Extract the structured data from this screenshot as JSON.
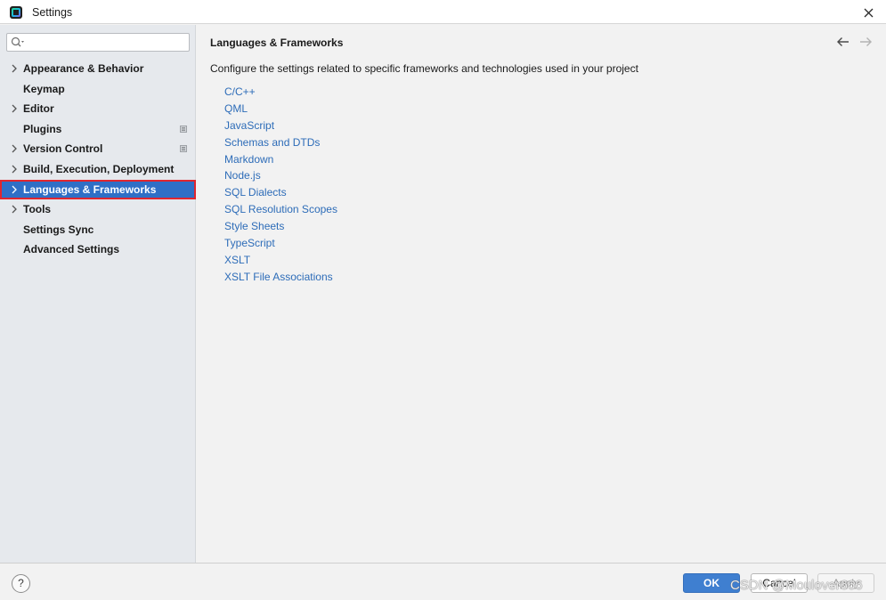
{
  "window": {
    "title": "Settings"
  },
  "sidebar": {
    "search": {
      "placeholder": "",
      "value": ""
    },
    "items": [
      {
        "label": "Appearance & Behavior",
        "has_chevron": true,
        "selected": false,
        "badge": false
      },
      {
        "label": "Keymap",
        "has_chevron": false,
        "selected": false,
        "badge": false
      },
      {
        "label": "Editor",
        "has_chevron": true,
        "selected": false,
        "badge": false
      },
      {
        "label": "Plugins",
        "has_chevron": false,
        "selected": false,
        "badge": true
      },
      {
        "label": "Version Control",
        "has_chevron": true,
        "selected": false,
        "badge": true
      },
      {
        "label": "Build, Execution, Deployment",
        "has_chevron": true,
        "selected": false,
        "badge": false
      },
      {
        "label": "Languages & Frameworks",
        "has_chevron": true,
        "selected": true,
        "badge": false
      },
      {
        "label": "Tools",
        "has_chevron": true,
        "selected": false,
        "badge": false
      },
      {
        "label": "Settings Sync",
        "has_chevron": false,
        "selected": false,
        "badge": false
      },
      {
        "label": "Advanced Settings",
        "has_chevron": false,
        "selected": false,
        "badge": false
      }
    ]
  },
  "main": {
    "title": "Languages & Frameworks",
    "description": "Configure the settings related to specific frameworks and technologies used in your project",
    "links": [
      "C/C++",
      "QML",
      "JavaScript",
      "Schemas and DTDs",
      "Markdown",
      "Node.js",
      "SQL Dialects",
      "SQL Resolution Scopes",
      "Style Sheets",
      "TypeScript",
      "XSLT",
      "XSLT File Associations"
    ]
  },
  "footer": {
    "help_label": "?",
    "ok_label": "OK",
    "cancel_label": "Cancel",
    "apply_label": "Apply",
    "watermark": "CSDN @Moulover666"
  },
  "colors": {
    "selection": "#2f6fc6",
    "selection_outline": "#e0262f",
    "link": "#2d6cb8",
    "ok_button": "#3f7fd0"
  }
}
